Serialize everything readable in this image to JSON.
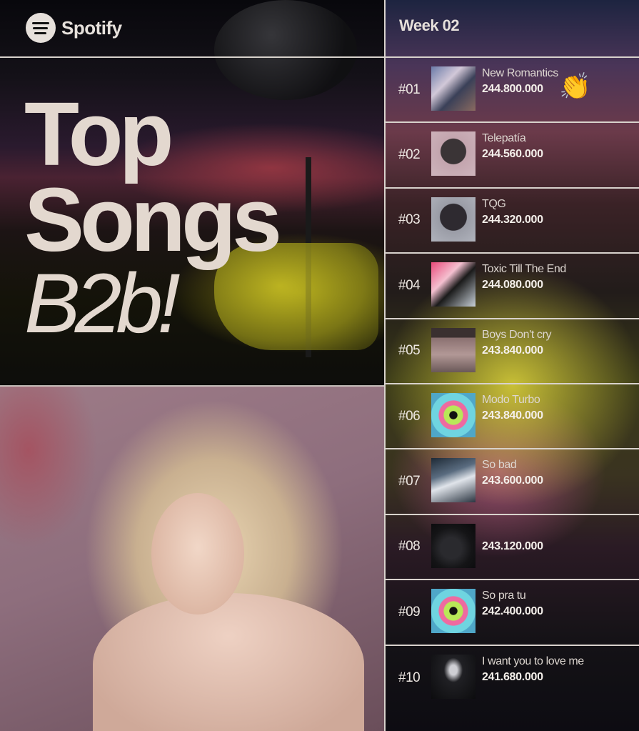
{
  "header": {
    "brand": "Spotify",
    "week": "Week 02"
  },
  "title": {
    "line1": "Top",
    "line2": "Songs",
    "line3": "B2b!"
  },
  "chart_data": {
    "type": "table",
    "columns": [
      "rank",
      "song",
      "streams"
    ],
    "rows": [
      {
        "rank": "#01",
        "song": "New Romantics",
        "streams": "244.800.000"
      },
      {
        "rank": "#02",
        "song": "Telepatía",
        "streams": "244.560.000"
      },
      {
        "rank": "#03",
        "song": "TQG",
        "streams": "244.320.000"
      },
      {
        "rank": "#04",
        "song": "Toxic Till The End",
        "streams": "244.080.000"
      },
      {
        "rank": "#05",
        "song": "Boys Don't cry",
        "streams": "243.840.000"
      },
      {
        "rank": "#06",
        "song": "Modo Turbo",
        "streams": "243.840.000"
      },
      {
        "rank": "#07",
        "song": "So bad",
        "streams": "243.600.000"
      },
      {
        "rank": "#08",
        "song": "",
        "streams": "243.120.000"
      },
      {
        "rank": "#09",
        "song": "So pra tu",
        "streams": "242.400.000"
      },
      {
        "rank": "#10",
        "song": "I want you to love me",
        "streams": "241.680.000"
      }
    ]
  },
  "decor": {
    "clap_icon": "👏"
  }
}
